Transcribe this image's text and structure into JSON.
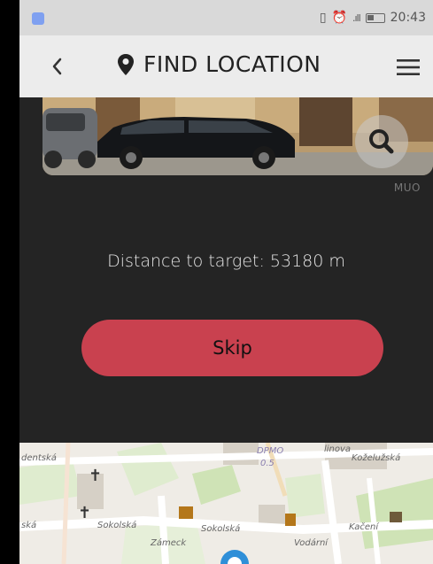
{
  "status_bar": {
    "time": "20:43"
  },
  "app_bar": {
    "title": "FIND LOCATION",
    "back_icon": "chevron-left-icon",
    "title_icon": "map-pin-icon",
    "menu_icon": "hamburger-menu-icon"
  },
  "photo": {
    "source_label": "MUO",
    "search_icon": "search-icon"
  },
  "distance_text": "Distance to target: 53180 m",
  "skip_button": {
    "label": "Skip",
    "color": "#c9414f"
  },
  "map": {
    "labels": [
      "dentská",
      "Sokolská",
      "Sokolská",
      "DPMO",
      "0.5",
      "Koželužská",
      "Kačení",
      "Vodární",
      "ská",
      "Zámeck",
      "linova"
    ]
  },
  "colors": {
    "background": "#242424",
    "app_bar": "#ececec",
    "status_bar": "#d9d9d9"
  }
}
